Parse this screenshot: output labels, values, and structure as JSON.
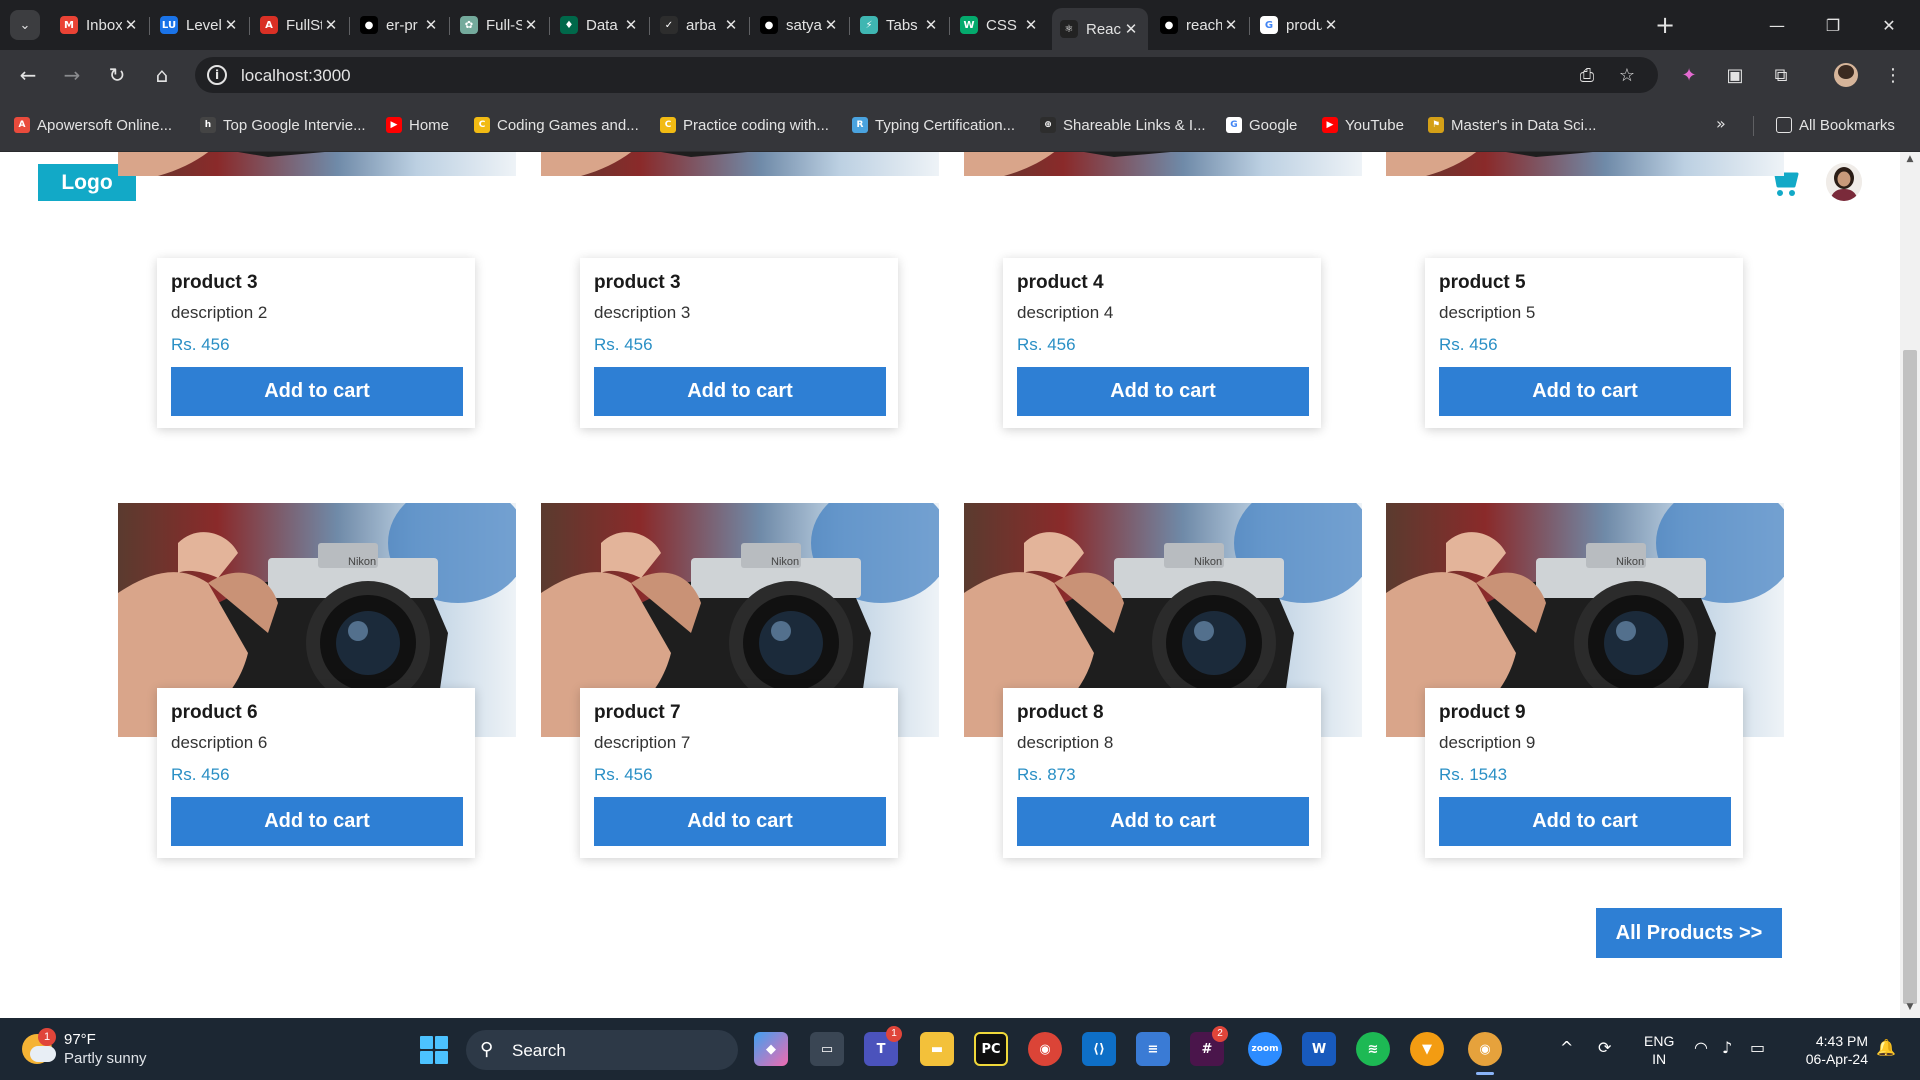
{
  "browser": {
    "tabs": [
      {
        "title": "Inbox",
        "icon": "gmail-icon",
        "color": "#ea4335",
        "glyph": "M"
      },
      {
        "title": "Level",
        "icon": "lu-icon",
        "color": "#1a73e8",
        "glyph": "LU"
      },
      {
        "title": "FullSt",
        "icon": "pdf-icon",
        "color": "#d93025",
        "glyph": "A"
      },
      {
        "title": "er-pr",
        "icon": "github-icon",
        "color": "#000000",
        "glyph": "●"
      },
      {
        "title": "Full-S",
        "icon": "chatgpt-icon",
        "color": "#74aa9c",
        "glyph": "✿"
      },
      {
        "title": "Data",
        "icon": "mongodb-icon",
        "color": "#00684a",
        "glyph": "♦"
      },
      {
        "title": "arba",
        "icon": "deploy-icon",
        "color": "#2d2d2d",
        "glyph": "✓"
      },
      {
        "title": "satya",
        "icon": "github-icon",
        "color": "#000000",
        "glyph": "●"
      },
      {
        "title": "Tabs",
        "icon": "bolt-icon",
        "color": "#3fb6b2",
        "glyph": "⚡"
      },
      {
        "title": "CSS I",
        "icon": "w3schools-icon",
        "color": "#04aa6d",
        "glyph": "W"
      },
      {
        "title": "Reac",
        "icon": "react-icon",
        "color": "#222222",
        "glyph": "⚛"
      },
      {
        "title": "reach",
        "icon": "github-icon",
        "color": "#000000",
        "glyph": "●"
      },
      {
        "title": "produ",
        "icon": "google-icon",
        "color": "#ffffff",
        "glyph": "G"
      }
    ],
    "active_tab_index": 10,
    "url": "localhost:3000",
    "bookmarks": [
      {
        "label": "Apowersoft Online...",
        "icon": "apowersoft-icon",
        "color": "#e94b3c",
        "glyph": "A"
      },
      {
        "label": "Top Google Intervie...",
        "icon": "bookmark-site-icon",
        "color": "#444",
        "glyph": "h"
      },
      {
        "label": "Home",
        "icon": "youtube-icon",
        "color": "#ff0000",
        "glyph": "▶"
      },
      {
        "label": "Coding Games and...",
        "icon": "codingame-icon",
        "color": "#f2bb13",
        "glyph": "C"
      },
      {
        "label": "Practice coding with...",
        "icon": "codewars-icon",
        "color": "#f2bb13",
        "glyph": "C"
      },
      {
        "label": "Typing Certification...",
        "icon": "typing-icon",
        "color": "#4aa3df",
        "glyph": "R"
      },
      {
        "label": "Shareable Links & I...",
        "icon": "link-icon",
        "color": "#2d2d2d",
        "glyph": "⊕"
      },
      {
        "label": "Google",
        "icon": "google-icon",
        "color": "#ffffff",
        "glyph": "G"
      },
      {
        "label": "YouTube",
        "icon": "youtube-icon",
        "color": "#ff0000",
        "glyph": "▶"
      },
      {
        "label": "Master's in Data Sci...",
        "icon": "graduation-icon",
        "color": "#d4a017",
        "glyph": "⚑"
      }
    ],
    "all_bookmarks": "All Bookmarks"
  },
  "page": {
    "logo": "Logo",
    "products": [
      {
        "name": "product 3",
        "description": "description 2",
        "price": "Rs. 456",
        "button": "Add to cart"
      },
      {
        "name": "product 3",
        "description": "description 3",
        "price": "Rs. 456",
        "button": "Add to cart"
      },
      {
        "name": "product 4",
        "description": "description 4",
        "price": "Rs. 456",
        "button": "Add to cart"
      },
      {
        "name": "product 5",
        "description": "description 5",
        "price": "Rs. 456",
        "button": "Add to cart"
      },
      {
        "name": "product 6",
        "description": "description 6",
        "price": "Rs. 456",
        "button": "Add to cart"
      },
      {
        "name": "product 7",
        "description": "description 7",
        "price": "Rs. 456",
        "button": "Add to cart"
      },
      {
        "name": "product 8",
        "description": "description 8",
        "price": "Rs. 873",
        "button": "Add to cart"
      },
      {
        "name": "product 9",
        "description": "description 9",
        "price": "Rs. 1543",
        "button": "Add to cart"
      }
    ],
    "all_products_button": "All Products >>",
    "colors": {
      "logo_bg": "#12a9c7",
      "button_bg": "#2e7fd4",
      "price_text": "#2a8fc5",
      "cart_icon": "#12a9c7"
    }
  },
  "taskbar": {
    "weather_temp": "97°F",
    "weather_condition": "Partly sunny",
    "weather_badge": "1",
    "search_label": "Search",
    "lang_line1": "ENG",
    "lang_line2": "IN",
    "time": "4:43 PM",
    "date": "06-Apr-24",
    "teams_badge": "1",
    "slack_badge": "2"
  }
}
